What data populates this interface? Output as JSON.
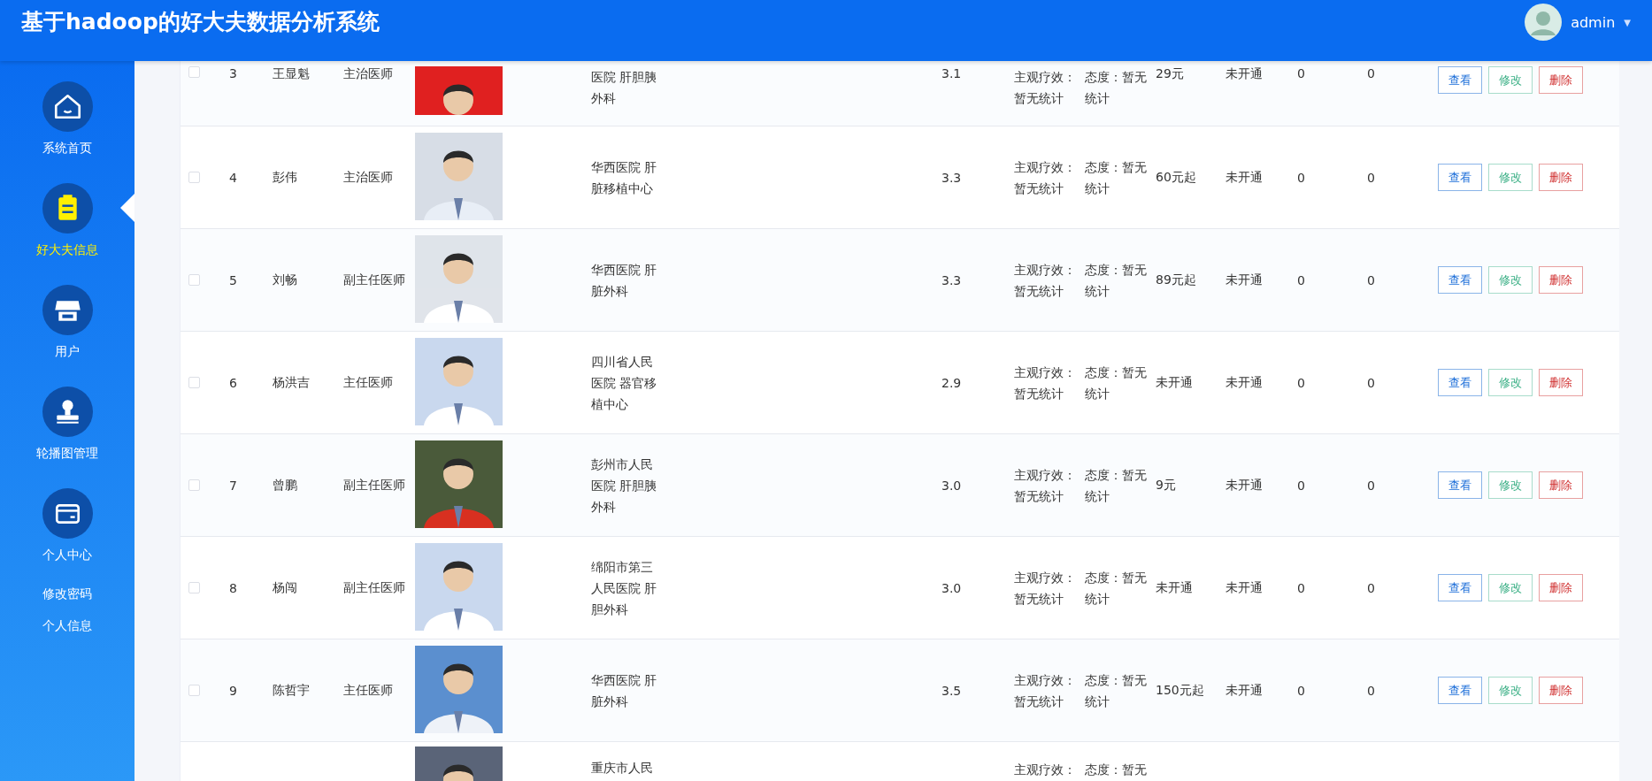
{
  "header": {
    "title": "基于hadoop的好大夫数据分析系统",
    "user": "admin",
    "caret": "▼"
  },
  "sidebar": {
    "items": [
      {
        "label": "系统首页",
        "kind": "main",
        "selected": false
      },
      {
        "label": "好大夫信息",
        "kind": "main",
        "selected": true
      },
      {
        "label": "用户",
        "kind": "main",
        "selected": false
      },
      {
        "label": "轮播图管理",
        "kind": "main",
        "selected": false
      },
      {
        "label": "个人中心",
        "kind": "main",
        "selected": false
      },
      {
        "label": "修改密码",
        "kind": "sub",
        "selected": false
      },
      {
        "label": "个人信息",
        "kind": "sub",
        "selected": false
      }
    ]
  },
  "table": {
    "rows": [
      {
        "kind": "cut-top",
        "checked": false,
        "number": "3",
        "name": "王显魁",
        "title": "主治医师",
        "hospital": "医院 肝胆胰外科",
        "score": "3.1",
        "effect": "主观疗效：暂无统计",
        "attitude": "态度：暂无统计",
        "price": "29元",
        "status": "未开通",
        "count_1": "0",
        "count_2": "0",
        "actions": [
          {
            "kind": "view",
            "label": "查看"
          },
          {
            "kind": "edit",
            "label": "修改"
          },
          {
            "kind": "delete",
            "label": "删除"
          }
        ]
      },
      {
        "kind": "full",
        "checked": false,
        "number": "4",
        "name": "彭伟",
        "title": "主治医师",
        "hospital": "华西医院 肝脏移植中心",
        "score": "3.3",
        "effect": "主观疗效：暂无统计",
        "attitude": "态度：暂无统计",
        "price": "60元起",
        "status": "未开通",
        "count_1": "0",
        "count_2": "0",
        "actions": [
          {
            "kind": "view",
            "label": "查看"
          },
          {
            "kind": "edit",
            "label": "修改"
          },
          {
            "kind": "delete",
            "label": "删除"
          }
        ]
      },
      {
        "kind": "full",
        "checked": false,
        "number": "5",
        "name": "刘畅",
        "title": "副主任医师",
        "hospital": "华西医院 肝脏外科",
        "score": "3.3",
        "effect": "主观疗效：暂无统计",
        "attitude": "态度：暂无统计",
        "price": "89元起",
        "status": "未开通",
        "count_1": "0",
        "count_2": "0",
        "actions": [
          {
            "kind": "view",
            "label": "查看"
          },
          {
            "kind": "edit",
            "label": "修改"
          },
          {
            "kind": "delete",
            "label": "删除"
          }
        ]
      },
      {
        "kind": "full",
        "checked": false,
        "number": "6",
        "name": "杨洪吉",
        "title": "主任医师",
        "hospital": "四川省人民医院 器官移植中心",
        "score": "2.9",
        "effect": "主观疗效：暂无统计",
        "attitude": "态度：暂无统计",
        "price": "未开通",
        "status": "未开通",
        "count_1": "0",
        "count_2": "0",
        "actions": [
          {
            "kind": "view",
            "label": "查看"
          },
          {
            "kind": "edit",
            "label": "修改"
          },
          {
            "kind": "delete",
            "label": "删除"
          }
        ]
      },
      {
        "kind": "full",
        "checked": false,
        "number": "7",
        "name": "曾鹏",
        "title": "副主任医师",
        "hospital": "彭州市人民医院 肝胆胰外科",
        "score": "3.0",
        "effect": "主观疗效：暂无统计",
        "attitude": "态度：暂无统计",
        "price": "9元",
        "status": "未开通",
        "count_1": "0",
        "count_2": "0",
        "actions": [
          {
            "kind": "view",
            "label": "查看"
          },
          {
            "kind": "edit",
            "label": "修改"
          },
          {
            "kind": "delete",
            "label": "删除"
          }
        ]
      },
      {
        "kind": "full",
        "checked": false,
        "number": "8",
        "name": "杨闯",
        "title": "副主任医师",
        "hospital": "绵阳市第三人民医院 肝胆外科",
        "score": "3.0",
        "effect": "主观疗效：暂无统计",
        "attitude": "态度：暂无统计",
        "price": "未开通",
        "status": "未开通",
        "count_1": "0",
        "count_2": "0",
        "actions": [
          {
            "kind": "view",
            "label": "查看"
          },
          {
            "kind": "edit",
            "label": "修改"
          },
          {
            "kind": "delete",
            "label": "删除"
          }
        ]
      },
      {
        "kind": "full",
        "checked": false,
        "number": "9",
        "name": "陈哲宇",
        "title": "主任医师",
        "hospital": "华西医院 肝脏外科",
        "score": "3.5",
        "effect": "主观疗效：暂无统计",
        "attitude": "态度：暂无统计",
        "price": "150元起",
        "status": "未开通",
        "count_1": "0",
        "count_2": "0",
        "actions": [
          {
            "kind": "view",
            "label": "查看"
          },
          {
            "kind": "edit",
            "label": "修改"
          },
          {
            "kind": "delete",
            "label": "删除"
          }
        ]
      },
      {
        "kind": "cut-bottom",
        "hospital": "重庆市人民",
        "effect": "主观疗效：",
        "attitude": "态度：暂无"
      }
    ]
  }
}
